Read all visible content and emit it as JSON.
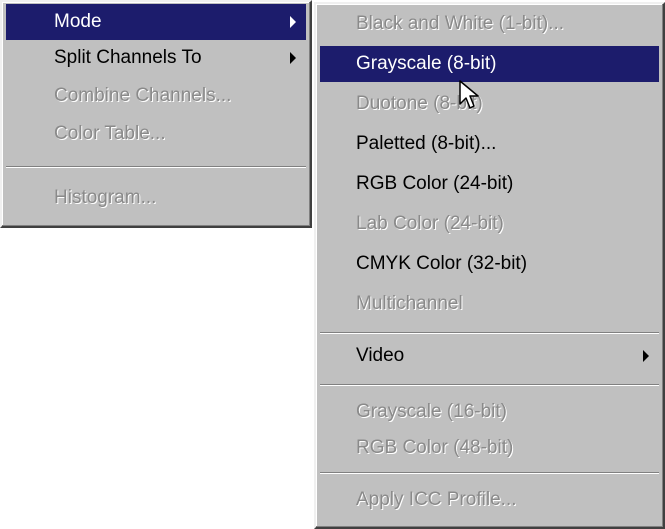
{
  "left_menu": {
    "items": [
      {
        "label": "Mode",
        "state": "selected",
        "submenu": true
      },
      {
        "label": "Split Channels To",
        "state": "enabled",
        "submenu": true
      },
      {
        "label": "Combine Channels...",
        "state": "disabled",
        "submenu": false
      },
      {
        "label": "Color Table...",
        "state": "disabled",
        "submenu": false
      },
      {
        "label": "Histogram...",
        "state": "disabled",
        "submenu": false
      }
    ]
  },
  "mode_submenu": {
    "items": [
      {
        "label": "Black and White (1-bit)...",
        "state": "disabled"
      },
      {
        "label": "Grayscale (8-bit)",
        "state": "selected"
      },
      {
        "label": "Duotone (8-bit)",
        "state": "disabled"
      },
      {
        "label": "Paletted (8-bit)...",
        "state": "enabled"
      },
      {
        "label": "RGB Color (24-bit)",
        "state": "enabled"
      },
      {
        "label": "Lab Color (24-bit)",
        "state": "disabled"
      },
      {
        "label": "CMYK Color (32-bit)",
        "state": "enabled"
      },
      {
        "label": "Multichannel",
        "state": "disabled"
      },
      {
        "label": "Video",
        "state": "enabled",
        "submenu": true
      },
      {
        "label": "Grayscale (16-bit)",
        "state": "disabled"
      },
      {
        "label": "RGB Color (48-bit)",
        "state": "disabled"
      },
      {
        "label": "Apply ICC Profile...",
        "state": "disabled"
      }
    ]
  },
  "colors": {
    "menu_face": "#c0c0c0",
    "highlight": "#1c1c6c",
    "disabled_text": "#8a8a8a"
  },
  "icons": {
    "submenu_arrow": "triangle-right",
    "cursor": "arrow-pointer"
  }
}
